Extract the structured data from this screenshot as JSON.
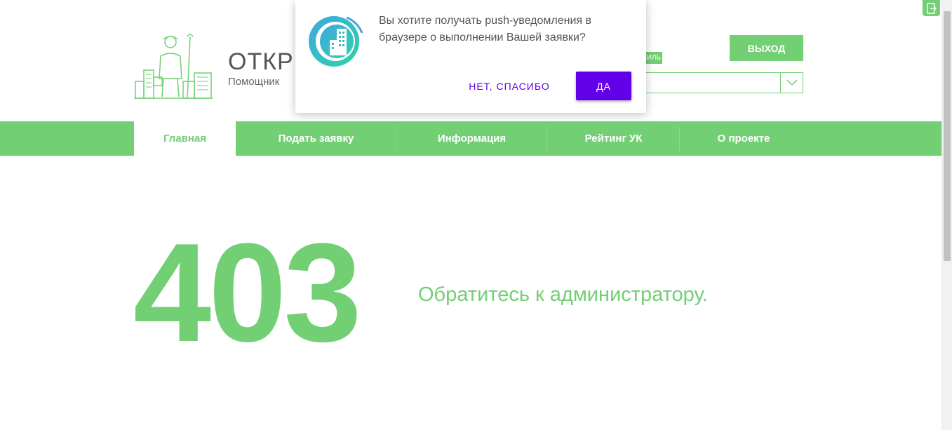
{
  "header": {
    "brand_title": "ОТКР",
    "brand_subtitle": "Помощник",
    "logout_label": "ВЫХОД",
    "profile_tag": "ИЛЬ",
    "address_value": ""
  },
  "nav": {
    "items": [
      {
        "label": "Главная",
        "active": true
      },
      {
        "label": "Подать заявку",
        "active": false
      },
      {
        "label": "Информация",
        "active": false
      },
      {
        "label": "Рейтинг УК",
        "active": false
      },
      {
        "label": "О проекте",
        "active": false
      }
    ]
  },
  "error": {
    "code": "403",
    "message": "Обратитесь к администратору."
  },
  "popup": {
    "text": "Вы хотите получать push-уведомления в браузере о выполнении Вашей заявки?",
    "no_label": "НЕТ, СПАСИБО",
    "yes_label": "ДА"
  },
  "colors": {
    "brand_green": "#72cf74",
    "popup_accent": "#6200ea"
  },
  "icons": {
    "logo": "worker-city-logo",
    "popup": "city-building-icon",
    "chevron": "chevron-down-icon",
    "extension": "extension-icon"
  }
}
